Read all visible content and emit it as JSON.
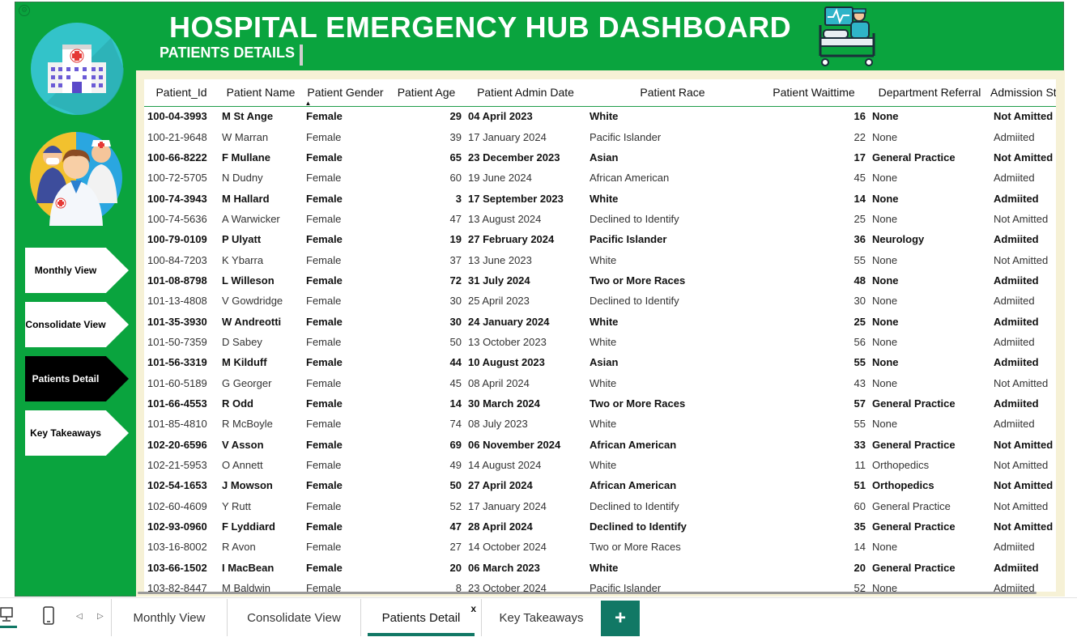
{
  "header": {
    "title": "HOSPITAL EMERGENCY HUB DASHBOARD",
    "subtitle": "PATIENTS DETAILS"
  },
  "nav_buttons": [
    {
      "label": "Monthly View",
      "active": false
    },
    {
      "label": "Consolidate View",
      "active": false
    },
    {
      "label": "Patients Detail",
      "active": true
    },
    {
      "label": "Key Takeaways",
      "active": false
    }
  ],
  "table": {
    "columns": [
      "Patient_Id",
      "Patient Name",
      "Patient Gender",
      "Patient Age",
      "Patient Admin Date",
      "Patient Race",
      "Patient Waittime",
      "Department Referral",
      "Admission Status"
    ],
    "sorted_column": "Patient Gender",
    "rows": [
      [
        "100-04-3993",
        "M St Ange",
        "Female",
        "29",
        "04 April 2023",
        "White",
        "16",
        "None",
        "Not Amitted"
      ],
      [
        "100-21-9648",
        "W Marran",
        "Female",
        "39",
        "17 January 2024",
        "Pacific Islander",
        "22",
        "None",
        "Admiited"
      ],
      [
        "100-66-8222",
        "F Mullane",
        "Female",
        "65",
        "23 December 2023",
        "Asian",
        "17",
        "General Practice",
        "Not Amitted"
      ],
      [
        "100-72-5705",
        "N Dudny",
        "Female",
        "60",
        "19 June 2024",
        "African American",
        "45",
        "None",
        "Admiited"
      ],
      [
        "100-74-3943",
        "M Hallard",
        "Female",
        "3",
        "17 September 2023",
        "White",
        "14",
        "None",
        "Admiited"
      ],
      [
        "100-74-5636",
        "A Warwicker",
        "Female",
        "47",
        "13 August 2024",
        "Declined to Identify",
        "25",
        "None",
        "Not Amitted"
      ],
      [
        "100-79-0109",
        "P Ulyatt",
        "Female",
        "19",
        "27 February 2024",
        "Pacific Islander",
        "36",
        "Neurology",
        "Admiited"
      ],
      [
        "100-84-7203",
        "K Ybarra",
        "Female",
        "37",
        "13 June 2023",
        "White",
        "55",
        "None",
        "Not Amitted"
      ],
      [
        "101-08-8798",
        "L Willeson",
        "Female",
        "72",
        "31 July 2024",
        "Two or More Races",
        "48",
        "None",
        "Admiited"
      ],
      [
        "101-13-4808",
        "V Gowdridge",
        "Female",
        "30",
        "25 April 2023",
        "Declined to Identify",
        "30",
        "None",
        "Admiited"
      ],
      [
        "101-35-3930",
        "W Andreotti",
        "Female",
        "30",
        "24 January 2024",
        "White",
        "25",
        "None",
        "Admiited"
      ],
      [
        "101-50-7359",
        "D Sabey",
        "Female",
        "50",
        "13 October 2023",
        "White",
        "56",
        "None",
        "Admiited"
      ],
      [
        "101-56-3319",
        "M Kilduff",
        "Female",
        "44",
        "10 August 2023",
        "Asian",
        "55",
        "None",
        "Admiited"
      ],
      [
        "101-60-5189",
        "G Georger",
        "Female",
        "45",
        "08 April 2024",
        "White",
        "43",
        "None",
        "Not Amitted"
      ],
      [
        "101-66-4553",
        "R Odd",
        "Female",
        "14",
        "30 March 2024",
        "Two or More Races",
        "57",
        "General Practice",
        "Admiited"
      ],
      [
        "101-85-4810",
        "R McBoyle",
        "Female",
        "74",
        "08 July 2023",
        "White",
        "55",
        "None",
        "Admiited"
      ],
      [
        "102-20-6596",
        "V Asson",
        "Female",
        "69",
        "06 November 2024",
        "African American",
        "33",
        "General Practice",
        "Not Amitted"
      ],
      [
        "102-21-5953",
        "O Annett",
        "Female",
        "49",
        "14 August 2024",
        "White",
        "11",
        "Orthopedics",
        "Not Amitted"
      ],
      [
        "102-54-1653",
        "J Mowson",
        "Female",
        "50",
        "27 April 2024",
        "African American",
        "51",
        "Orthopedics",
        "Not Amitted"
      ],
      [
        "102-60-4609",
        "Y Rutt",
        "Female",
        "52",
        "17 January 2024",
        "Declined to Identify",
        "60",
        "General Practice",
        "Not Amitted"
      ],
      [
        "102-93-0960",
        "F Lyddiard",
        "Female",
        "47",
        "28 April 2024",
        "Declined to Identify",
        "35",
        "General Practice",
        "Not Amitted"
      ],
      [
        "103-16-8002",
        "R Avon",
        "Female",
        "27",
        "14 October 2024",
        "Two or More Races",
        "14",
        "None",
        "Admiited"
      ],
      [
        "103-66-1502",
        "I MacBean",
        "Female",
        "20",
        "06 March 2023",
        "White",
        "20",
        "General Practice",
        "Admiited"
      ],
      [
        "103-82-8447",
        "M Baldwin",
        "Female",
        "8",
        "23 October 2024",
        "Pacific Islander",
        "52",
        "None",
        "Admiited"
      ]
    ]
  },
  "page_tabs": [
    {
      "label": "Monthly View",
      "active": false
    },
    {
      "label": "Consolidate View",
      "active": false
    },
    {
      "label": "Patients Detail",
      "active": true
    },
    {
      "label": "Key Takeaways",
      "active": false
    }
  ],
  "tab_close_label": "x",
  "add_tab_label": "+",
  "icons": [
    "settings-icon",
    "hospital-icon",
    "doctors-icon",
    "hospital-bed-icon",
    "desktop-view-icon",
    "mobile-view-icon",
    "prev-arrow-icon",
    "next-arrow-icon",
    "sort-asc-icon"
  ],
  "colors": {
    "brand_green": "#0aa43e",
    "panel_cream": "#f6f1d6",
    "tab_accent": "#117865",
    "active_nav": "#000000"
  }
}
